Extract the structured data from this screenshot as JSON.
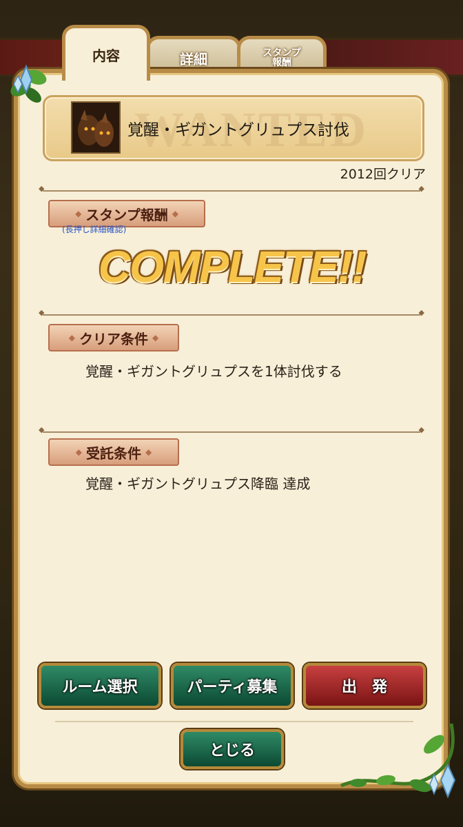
{
  "tabs": [
    {
      "label": "内容",
      "active": true
    },
    {
      "label": "詳細",
      "active": false
    },
    {
      "label": "スタンプ\n報酬",
      "active": false
    }
  ],
  "quest": {
    "title": "覚醒・ギガントグリュプス討伐",
    "watermark": "WANTED",
    "clear_count": "2012回クリア"
  },
  "stamp_section": {
    "heading": "スタンプ報酬",
    "hint": "(長押し詳細確認)",
    "status": "COMPLETE!!"
  },
  "clear_section": {
    "heading": "クリア条件",
    "text": "覚醒・ギガントグリュプスを1体討伐する"
  },
  "accept_section": {
    "heading": "受託条件",
    "text": "覚醒・ギガントグリュプス降臨 達成"
  },
  "buttons": {
    "room_select": "ルーム選択",
    "party_recruit": "パーティ募集",
    "depart": "出　発",
    "close": "とじる"
  },
  "colors": {
    "panel": "#f8efd9",
    "frame": "#b88c47",
    "button_green": "#1a6a4a",
    "button_red": "#a82828"
  }
}
